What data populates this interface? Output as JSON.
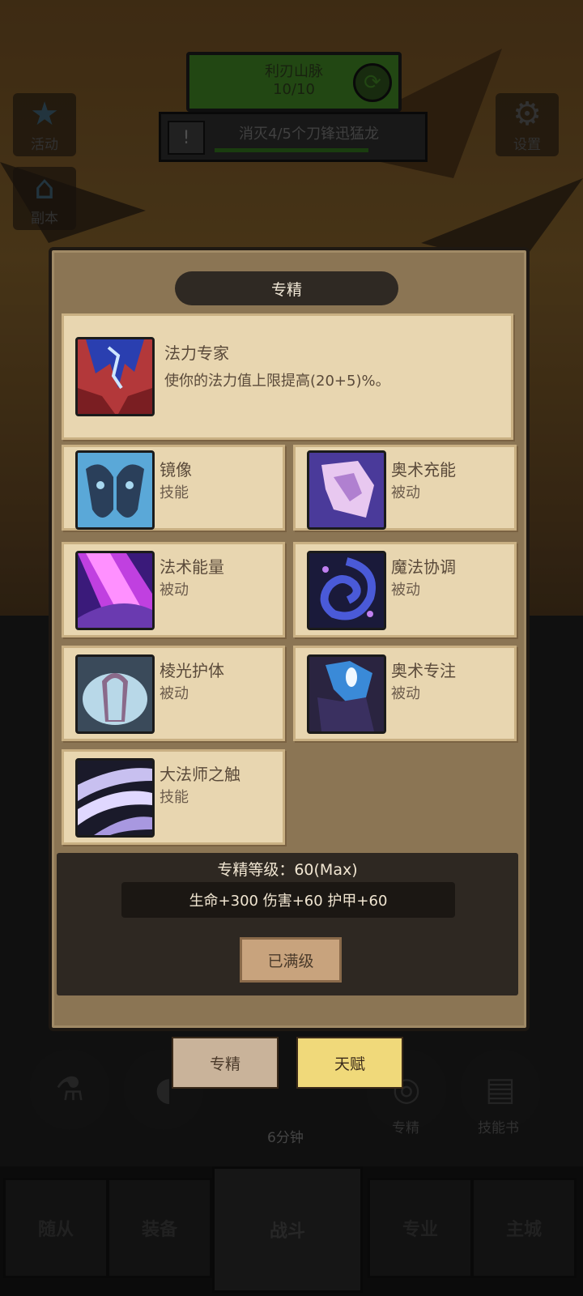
{
  "stage": {
    "name": "利刃山脉",
    "progress": "10/10"
  },
  "quest": {
    "text": "消灭4/5个刀锋迅猛龙"
  },
  "side_buttons": {
    "activity": "活动",
    "dungeon": "副本",
    "settings": "设置"
  },
  "modal": {
    "title": "专精",
    "featured": {
      "name": "法力专家",
      "description": "使你的法力值上限提高(20+5)%。"
    },
    "cards": [
      {
        "name": "镜像",
        "type": "技能"
      },
      {
        "name": "奥术充能",
        "type": "被动"
      },
      {
        "name": "法术能量",
        "type": "被动"
      },
      {
        "name": "魔法协调",
        "type": "被动"
      },
      {
        "name": "棱光护体",
        "type": "被动"
      },
      {
        "name": "奥术专注",
        "type": "被动"
      },
      {
        "name": "大法师之触",
        "type": "技能"
      }
    ],
    "level_text": "专精等级：60(Max)",
    "stats_text": "生命+300  伤害+60  护甲+60",
    "maxed_button": "已满级"
  },
  "tabs": {
    "spec": "专精",
    "talent": "天赋"
  },
  "slots": {
    "timer": "6分钟",
    "spec": "专精",
    "skillbook": "技能书"
  },
  "bottom_nav": {
    "followers": "随从",
    "equipment": "装备",
    "battle": "战斗",
    "profession": "专业",
    "city": "主城"
  },
  "colors": {
    "accent_green": "#3b7a22",
    "card_bg": "#e8d6b0",
    "talent_yellow": "#f0d97a"
  }
}
